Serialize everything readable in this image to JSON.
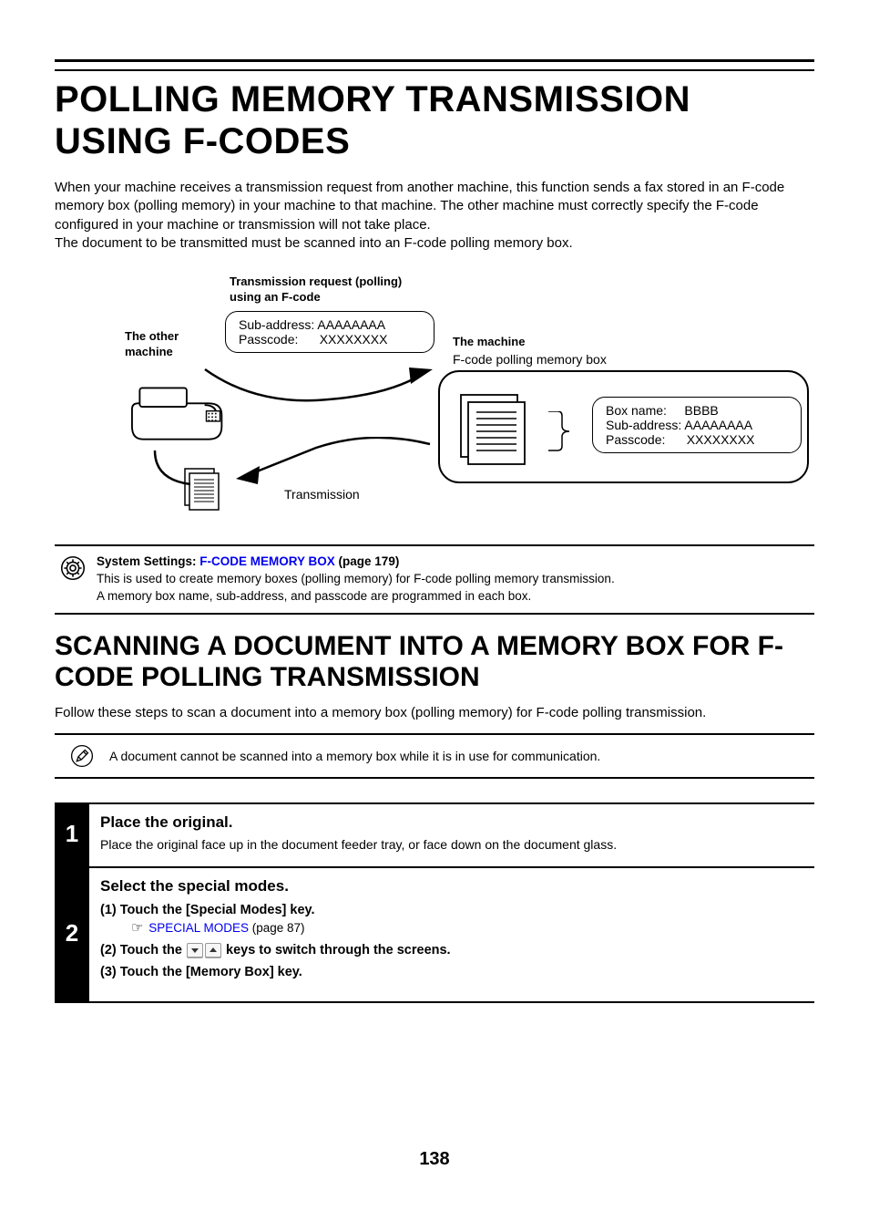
{
  "title": "POLLING MEMORY TRANSMISSION USING F-CODES",
  "intro": "When your machine receives a transmission request from another machine, this function sends a fax stored in an F-code memory box (polling memory) in your machine to that machine. The other machine must correctly specify the F-code configured in your machine or transmission will not take place.\nThe document to be transmitted must be scanned into an F-code polling memory box.",
  "diagram": {
    "request_title": "Transmission request (polling)\nusing an F-code",
    "other_label": "The other\nmachine",
    "req_sub_label": "Sub-address:",
    "req_sub_val": "AAAAAAAA",
    "req_pass_label": "Passcode:",
    "req_pass_val": "XXXXXXXX",
    "machine_title": "The machine",
    "machine_sub": "F-code polling memory box",
    "box_name_label": "Box name:",
    "box_name_val": "BBBB",
    "box_sub_label": "Sub-address:",
    "box_sub_val": "AAAAAAAA",
    "box_pass_label": "Passcode:",
    "box_pass_val": "XXXXXXXX",
    "transmission_label": "Transmission"
  },
  "settings": {
    "heading_pre": "System Settings: ",
    "heading_link": "F-CODE MEMORY BOX",
    "heading_post": " (page 179)",
    "line1": "This is used to create memory boxes (polling memory) for F-code polling memory transmission.",
    "line2": "A memory box name, sub-address, and passcode are programmed in each box."
  },
  "section2_title": "SCANNING A DOCUMENT INTO A MEMORY BOX FOR F-CODE POLLING TRANSMISSION",
  "section2_intro": "Follow these steps to scan a document into a memory box (polling memory) for F-code polling transmission.",
  "note": "A document cannot be scanned into a memory box while it is in use for communication.",
  "step1": {
    "num": "1",
    "title": "Place the original.",
    "desc": "Place the original face up in the document feeder tray, or face down on the document glass."
  },
  "step2": {
    "num": "2",
    "title": "Select the special modes.",
    "s1_pre": "(1)   Touch the [Special Modes] key.",
    "s1_link": "SPECIAL MODES",
    "s1_post": " (page 87)",
    "s2_pre": "(2)   Touch the ",
    "s2_post": " keys to switch through the screens.",
    "s3": "(3)   Touch the [Memory Box] key."
  },
  "page_num": "138"
}
